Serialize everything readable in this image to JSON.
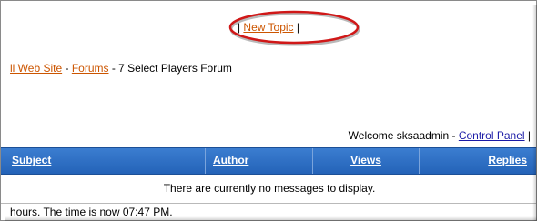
{
  "toolbar": {
    "pipe_left": "| ",
    "new_topic_label": "New Topic",
    "pipe_right": " |"
  },
  "breadcrumb": {
    "home_link": "ll Web Site",
    "sep1": " - ",
    "forums_link": "Forums",
    "sep2": " - ",
    "current": "7 Select Players Forum"
  },
  "welcome": {
    "text": "Welcome sksaadmin - ",
    "control_panel_link": "Control Panel",
    "trailing_pipe": " |"
  },
  "table": {
    "columns": [
      "Subject",
      "Author",
      "Views",
      "Replies"
    ],
    "empty_message": "There are currently no messages to display."
  },
  "footer": {
    "text": "hours. The time is now 07:47 PM."
  },
  "colors": {
    "header_bg": "#2e6ec4",
    "link": "#cc5500",
    "control_panel_link": "#1a1aa6",
    "highlight_ellipse": "#d01818"
  }
}
